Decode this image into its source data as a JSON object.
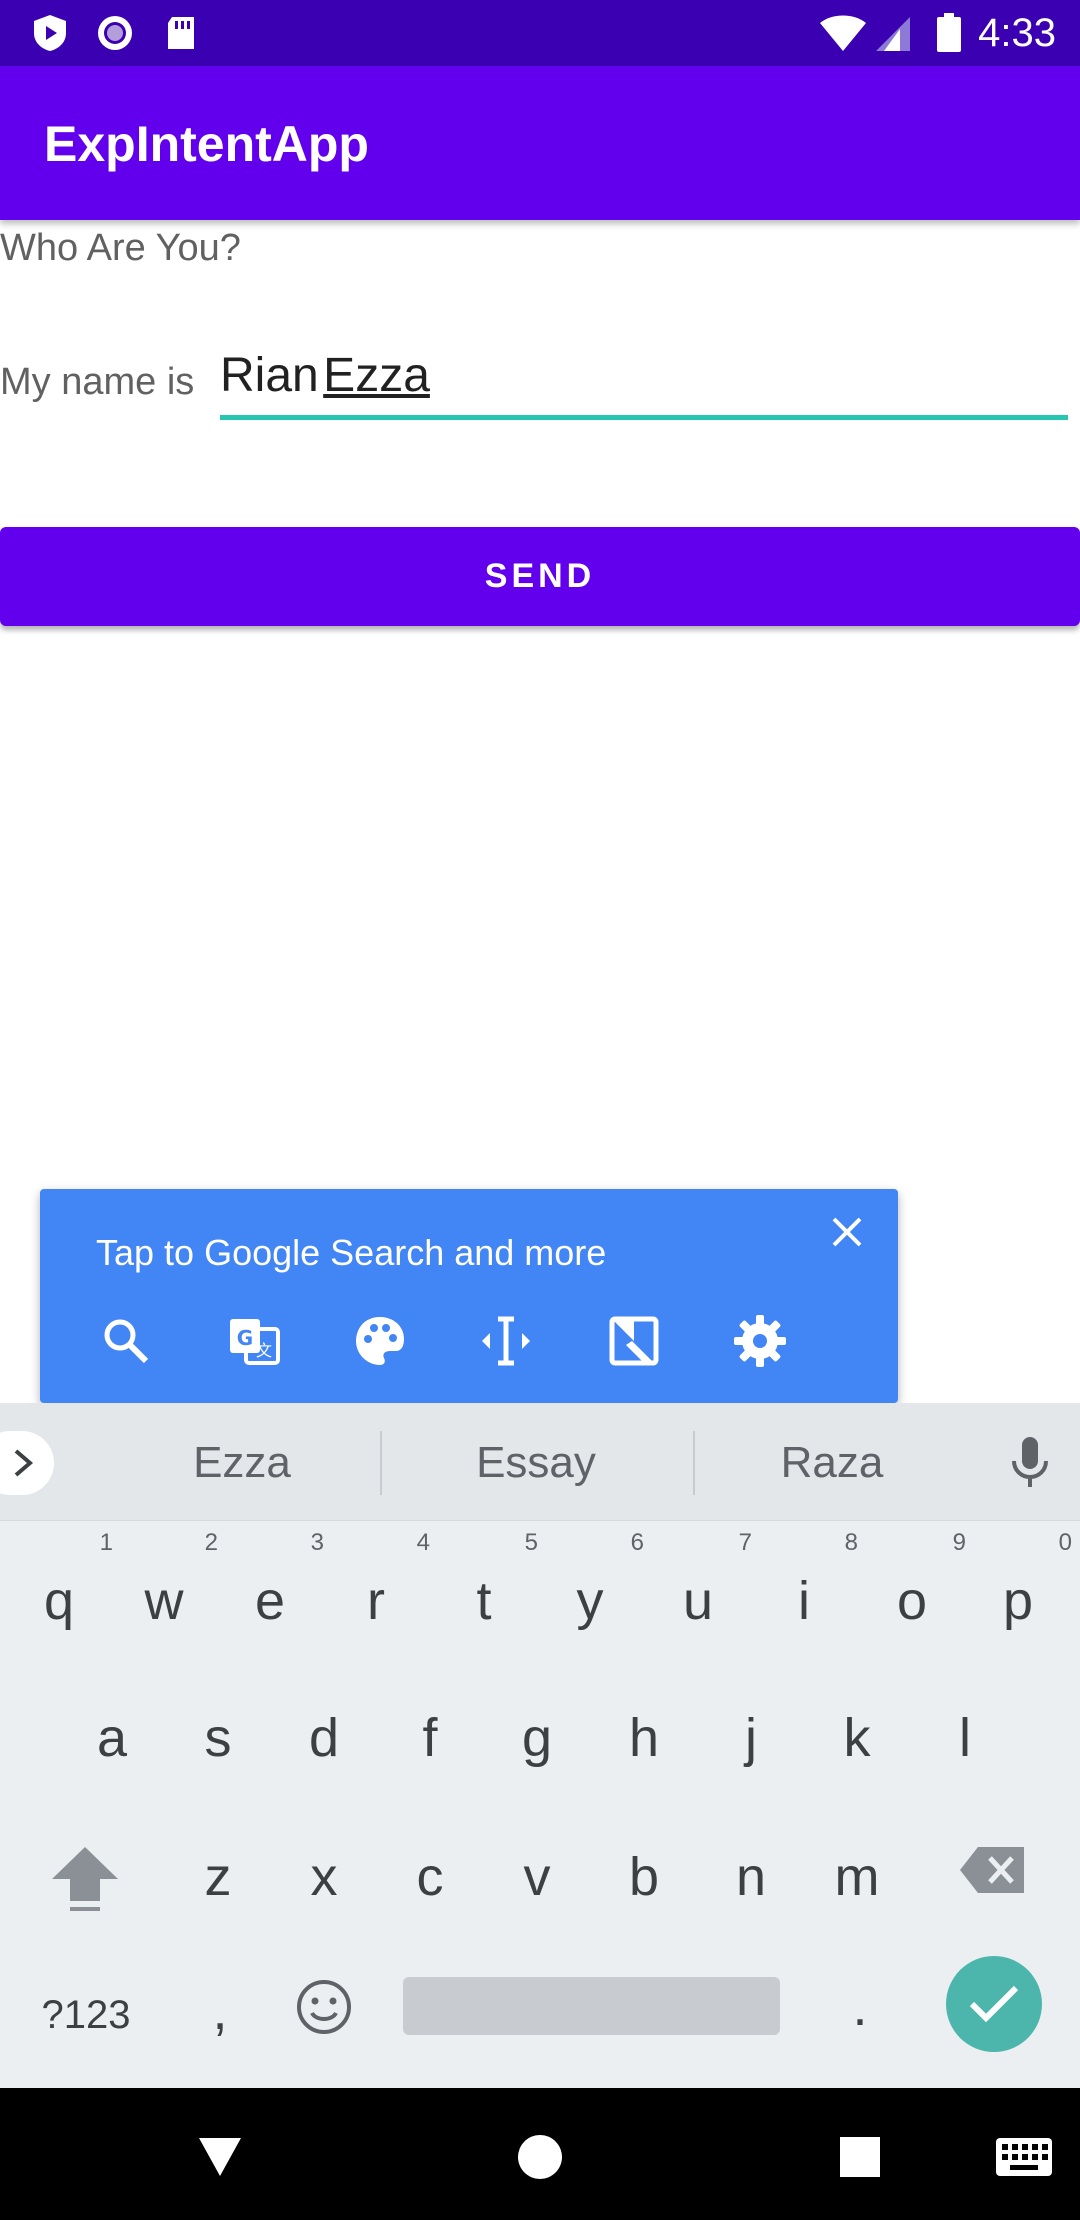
{
  "status_bar": {
    "time": "4:33",
    "icons": [
      "play-protect-icon",
      "circle-app-icon",
      "sd-card-icon",
      "wifi-icon",
      "signal-icon",
      "battery-icon"
    ]
  },
  "app_bar": {
    "title": "ExpIntentApp"
  },
  "form": {
    "prompt": "Who Are You?",
    "name_label": "My name is",
    "name_first": "Rian",
    "name_last": "Ezza",
    "send_label": "SEND"
  },
  "google_popup": {
    "text": "Tap to Google Search and more",
    "tools": [
      "search-icon",
      "translate-icon",
      "palette-icon",
      "text-cursor-icon",
      "screenshot-edit-icon",
      "gear-icon"
    ]
  },
  "keyboard": {
    "suggestions": [
      "Ezza",
      "Essay",
      "Raza"
    ],
    "row1": [
      {
        "k": "q",
        "h": "1"
      },
      {
        "k": "w",
        "h": "2"
      },
      {
        "k": "e",
        "h": "3"
      },
      {
        "k": "r",
        "h": "4"
      },
      {
        "k": "t",
        "h": "5"
      },
      {
        "k": "y",
        "h": "6"
      },
      {
        "k": "u",
        "h": "7"
      },
      {
        "k": "i",
        "h": "8"
      },
      {
        "k": "o",
        "h": "9"
      },
      {
        "k": "p",
        "h": "0"
      }
    ],
    "row2": [
      "a",
      "s",
      "d",
      "f",
      "g",
      "h",
      "j",
      "k",
      "l"
    ],
    "row3": [
      "z",
      "x",
      "c",
      "v",
      "b",
      "n",
      "m"
    ],
    "symbols_label": "?123",
    "comma_label": ",",
    "period_label": "."
  },
  "colors": {
    "status_bar": "#3a00b2",
    "primary": "#6200ee",
    "accent_underline": "#26c6b0",
    "google_blue": "#4285f4",
    "enter_key": "#4db6ac"
  }
}
